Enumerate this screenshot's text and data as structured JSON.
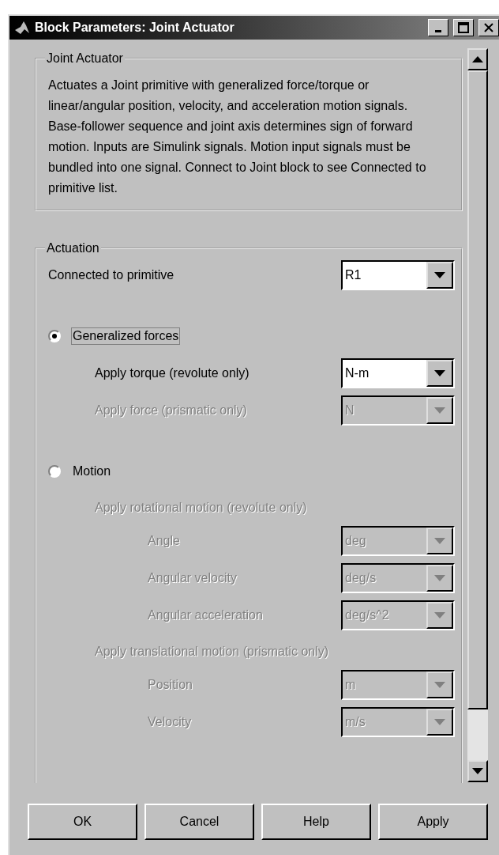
{
  "window": {
    "title": "Block Parameters: Joint Actuator"
  },
  "description": {
    "title": "Joint Actuator",
    "text": "Actuates a Joint primitive with generalized force/torque or linear/angular position, velocity, and acceleration motion signals. Base-follower sequence and joint axis determines sign of forward motion. Inputs are Simulink signals. Motion input signals must be bundled into one signal. Connect to Joint block to see Connected to primitive list."
  },
  "actuation": {
    "title": "Actuation",
    "items": [
      {
        "kind": "dropdown",
        "label": "Connected to primitive",
        "value": "R1",
        "disabled": false
      },
      {
        "kind": "radio",
        "label": "Generalized forces",
        "selected": true,
        "focused": true,
        "children": [
          {
            "kind": "dropdown",
            "label": "Apply torque (revolute only)",
            "value": "N-m",
            "disabled": false
          },
          {
            "kind": "dropdown",
            "label": "Apply force (prismatic only)",
            "value": "N",
            "disabled": true
          }
        ]
      },
      {
        "kind": "radio",
        "label": "Motion",
        "selected": false,
        "focused": false,
        "children": [
          {
            "kind": "heading",
            "label": "Apply rotational motion (revolute only)",
            "disabled": true,
            "children": [
              {
                "kind": "dropdown",
                "label": "Angle",
                "value": "deg",
                "disabled": true
              },
              {
                "kind": "dropdown",
                "label": "Angular velocity",
                "value": "deg/s",
                "disabled": true
              },
              {
                "kind": "dropdown",
                "label": "Angular acceleration",
                "value": "deg/s^2",
                "disabled": true
              }
            ]
          },
          {
            "kind": "heading",
            "label": "Apply translational motion (prismatic only)",
            "disabled": true,
            "children": [
              {
                "kind": "dropdown",
                "label": "Position",
                "value": "m",
                "disabled": true
              },
              {
                "kind": "dropdown",
                "label": "Velocity",
                "value": "m/s",
                "disabled": true
              }
            ]
          }
        ]
      }
    ]
  },
  "buttons": [
    {
      "label": "OK"
    },
    {
      "label": "Cancel"
    },
    {
      "label": "Help"
    },
    {
      "label": "Apply"
    }
  ]
}
